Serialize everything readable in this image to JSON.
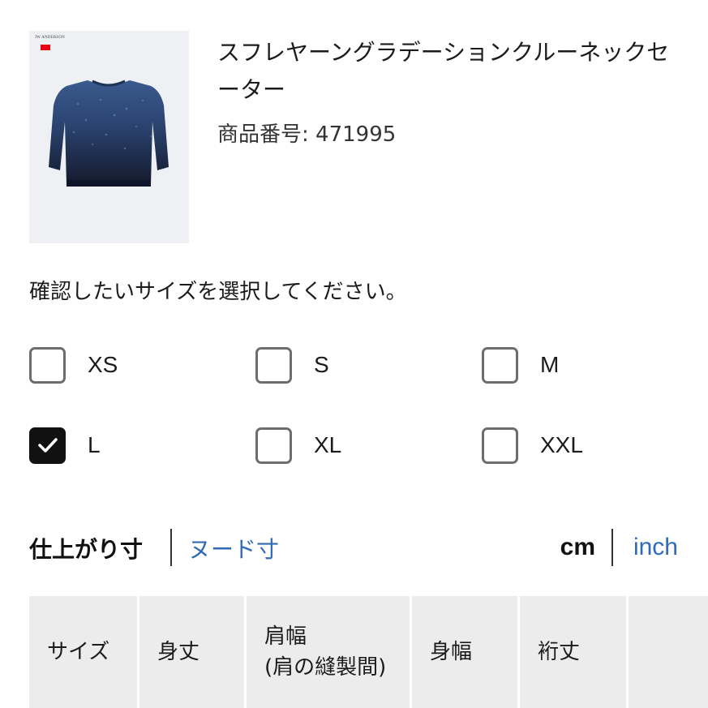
{
  "product": {
    "brand_logo_text": "JW ANDERSON",
    "title": "スフレヤーングラデーションクルーネックセーター",
    "code_label": "商品番号: ",
    "code_value": "471995",
    "colors": {
      "sweater_top": "#2e4a78",
      "sweater_bottom": "#161d32",
      "background": "#eef0f3",
      "brand_red": "#e60012"
    }
  },
  "size_select": {
    "prompt": "確認したいサイズを選択してください。",
    "options": [
      {
        "label": "XS",
        "checked": false
      },
      {
        "label": "S",
        "checked": false
      },
      {
        "label": "M",
        "checked": false
      },
      {
        "label": "L",
        "checked": true
      },
      {
        "label": "XL",
        "checked": false
      },
      {
        "label": "XXL",
        "checked": false
      }
    ]
  },
  "measure_tabs": {
    "finished": "仕上がり寸",
    "nude": "ヌード寸",
    "active": "仕上がり寸"
  },
  "units": {
    "cm": "cm",
    "inch": "inch",
    "active": "cm"
  },
  "table": {
    "headers": [
      {
        "line1": "サイズ"
      },
      {
        "line1": "身丈"
      },
      {
        "line1": "肩幅",
        "line2": "(肩の縫製間)"
      },
      {
        "line1": "身幅"
      },
      {
        "line1": "裄丈"
      },
      {
        "line1": ""
      }
    ]
  },
  "colors": {
    "link": "#2f6bb7",
    "checkbox_border": "#6d6d6d",
    "checked": "#111111",
    "table_header_bg": "#ececec"
  }
}
